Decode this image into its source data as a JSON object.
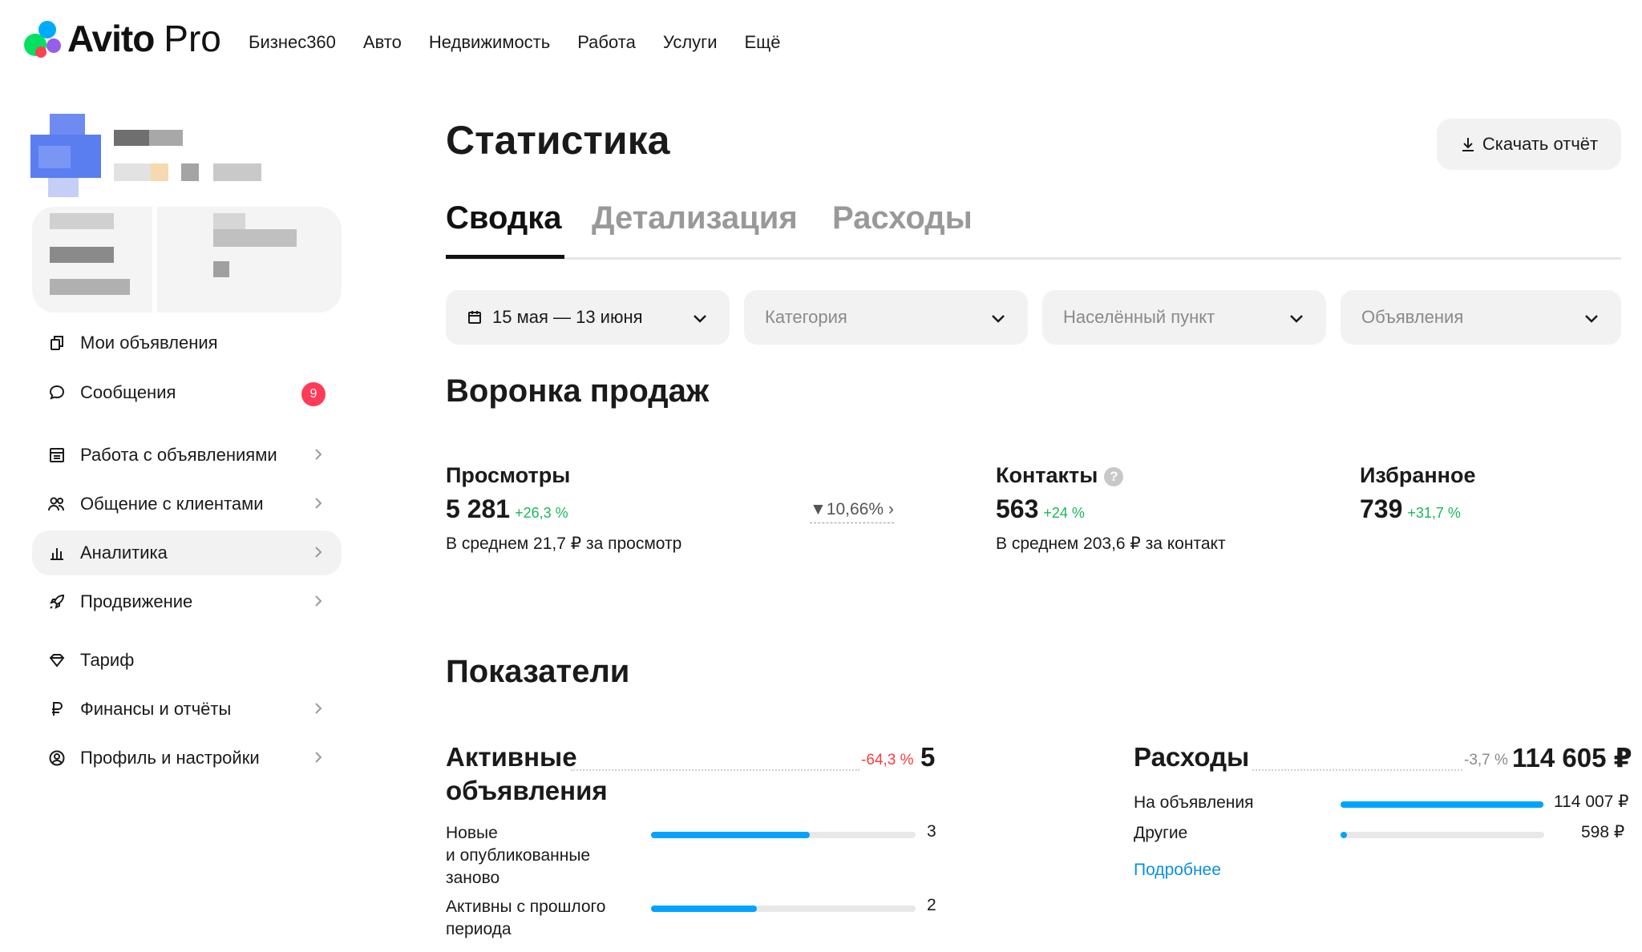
{
  "header": {
    "logo_text": "Avito",
    "logo_pro": "Pro",
    "nav": [
      "Бизнес360",
      "Авто",
      "Недвижимость",
      "Работа",
      "Услуги",
      "Ещё"
    ]
  },
  "sidebar": {
    "items": [
      {
        "label": "Мои объявления",
        "icon": "copy-icon",
        "chevron": false
      },
      {
        "label": "Сообщения",
        "icon": "chat-bubble-icon",
        "badge": "9"
      },
      {
        "label": "Работа с объявлениями",
        "icon": "listings-icon",
        "chevron": true
      },
      {
        "label": "Общение с клиентами",
        "icon": "users-icon",
        "chevron": true
      },
      {
        "label": "Аналитика",
        "icon": "bar-chart-icon",
        "chevron": true,
        "active": true
      },
      {
        "label": "Продвижение",
        "icon": "rocket-icon",
        "chevron": true
      },
      {
        "label": "Тариф",
        "icon": "diamond-icon",
        "chevron": false
      },
      {
        "label": "Финансы и отчёты",
        "icon": "ruble-icon",
        "chevron": true
      },
      {
        "label": "Профиль и настройки",
        "icon": "profile-icon",
        "chevron": true
      }
    ]
  },
  "main": {
    "title": "Статистика",
    "download_label": "Скачать отчёт",
    "tabs": [
      "Сводка",
      "Детализация",
      "Расходы"
    ],
    "filters": {
      "date": "15 мая — 13 июня",
      "category": "Категория",
      "location": "Населённый пункт",
      "ads": "Объявления"
    },
    "funnel": {
      "title": "Воронка продаж",
      "views": {
        "title": "Просмотры",
        "value": "5 281",
        "delta": "+26,3 %",
        "sub": "В среднем 21,7 ₽ за просмотр"
      },
      "conversion": "10,66%",
      "contacts": {
        "title": "Контакты",
        "help": "?",
        "value": "563",
        "delta": "+24 %",
        "sub": "В среднем 203,6 ₽ за контакт"
      },
      "favorites": {
        "title": "Избранное",
        "value": "739",
        "delta": "+31,7 %"
      }
    },
    "indicators": {
      "title": "Показатели",
      "active_ads": {
        "title_line1": "Активные",
        "title_line2": "объявления",
        "delta": "-64,3 %",
        "value": "5",
        "rows": [
          {
            "label_lines": [
              "Новые",
              "и опубликованные",
              "заново"
            ],
            "value": "3",
            "share": 0.6
          },
          {
            "label_lines": [
              "Активны с прошлого",
              "периода"
            ],
            "value": "2",
            "share": 0.4
          }
        ]
      },
      "expenses": {
        "title": "Расходы",
        "delta": "-3,7 %",
        "value": "114 605 ₽",
        "rows": [
          {
            "label": "На объявления",
            "value": "114 007 ₽",
            "share": 0.995
          },
          {
            "label": "Другие",
            "value": "598 ₽",
            "share": 0.03
          }
        ],
        "more_link": "Подробнее"
      }
    }
  },
  "colors": {
    "accent_blue": "#00a3ff",
    "positive": "#19b95a",
    "negative": "#ff3b3b",
    "badge": "#ff3b57"
  }
}
